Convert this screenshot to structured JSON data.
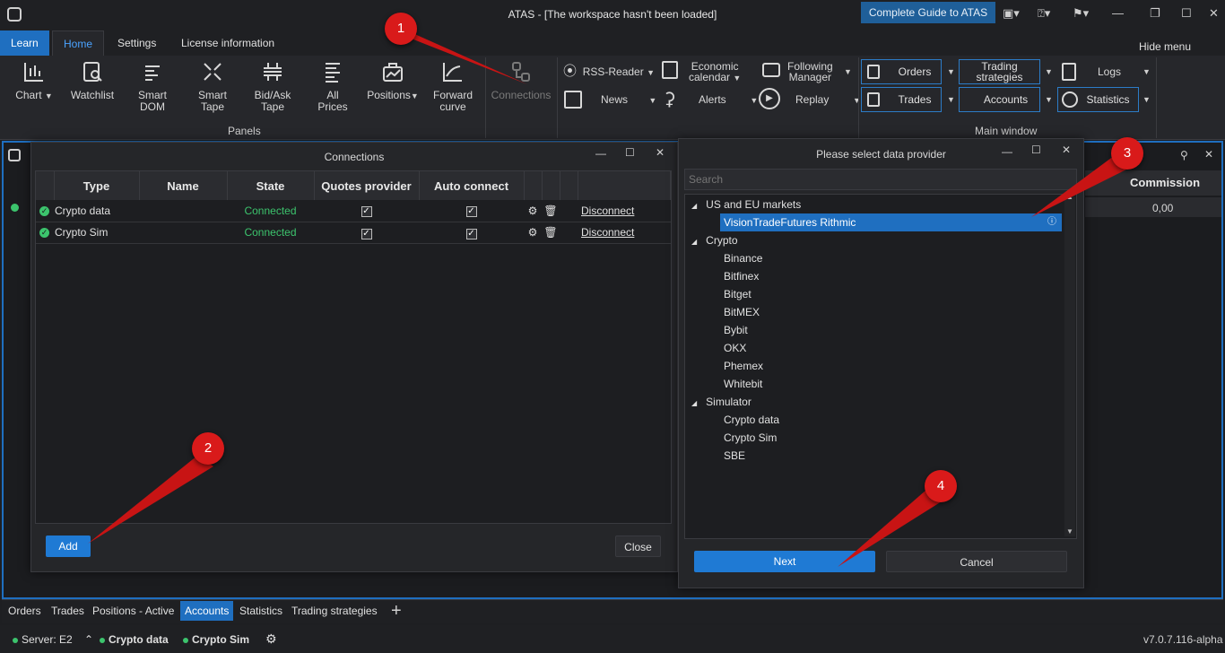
{
  "window": {
    "title": "ATAS - [The workspace hasn't been loaded]",
    "guide_button": "Complete Guide to ATAS"
  },
  "ribbon_tabs": [
    "Learn",
    "Home",
    "Settings",
    "License information"
  ],
  "hide_menu": "Hide menu",
  "panels": {
    "chart": "Chart",
    "watchlist": "Watchlist",
    "smart_dom": [
      "Smart",
      "DOM"
    ],
    "smart_tape": [
      "Smart",
      "Tape"
    ],
    "bidask_tape": [
      "Bid/Ask",
      "Tape"
    ],
    "all_prices": [
      "All",
      "Prices"
    ],
    "positions": "Positions",
    "forward_curve": [
      "Forward",
      "curve"
    ],
    "group_label": "Panels",
    "connections": "Connections"
  },
  "tools": {
    "rss": "RSS-Reader",
    "economic_calendar": [
      "Economic",
      "calendar"
    ],
    "following_manager": [
      "Following",
      "Manager"
    ],
    "news": "News",
    "alerts": "Alerts",
    "replay": "Replay"
  },
  "main_window": {
    "orders": "Orders",
    "trading_strategies": [
      "Trading",
      "strategies"
    ],
    "logs": "Logs",
    "trades": "Trades",
    "accounts": "Accounts",
    "statistics": "Statistics",
    "group_label": "Main window"
  },
  "connections_dialog": {
    "title": "Connections",
    "columns": [
      "Type",
      "Name",
      "State",
      "Quotes provider",
      "Auto connect"
    ],
    "rows": [
      {
        "type": "Crypto data",
        "name": "",
        "state": "Connected",
        "action": "Disconnect"
      },
      {
        "type": "Crypto Sim",
        "name": "",
        "state": "Connected",
        "action": "Disconnect"
      }
    ],
    "add": "Add",
    "close": "Close"
  },
  "provider_dialog": {
    "title": "Please select data provider",
    "search_placeholder": "Search",
    "groups": [
      {
        "name": "US and EU markets",
        "items": [
          "VisionTradeFutures Rithmic"
        ]
      },
      {
        "name": "Crypto",
        "items": [
          "Binance",
          "Bitfinex",
          "Bitget",
          "BitMEX",
          "Bybit",
          "OKX",
          "Phemex",
          "Whitebit"
        ]
      },
      {
        "name": "Simulator",
        "items": [
          "Crypto data",
          "Crypto Sim",
          "SBE"
        ]
      }
    ],
    "next": "Next",
    "cancel": "Cancel"
  },
  "background_panel": {
    "commission_header": "Commission",
    "commission_value": "0,00"
  },
  "bottom_tabs": [
    "Orders",
    "Trades",
    "Positions - Active",
    "Accounts",
    "Statistics",
    "Trading strategies"
  ],
  "status_bar": {
    "server": "Server: E2",
    "conn1": "Crypto data",
    "conn2": "Crypto Sim",
    "version": "v7.0.7.116-alpha"
  },
  "callouts": [
    "1",
    "2",
    "3",
    "4"
  ],
  "colors": {
    "accent": "#1f6fc0",
    "connected": "#3cc46d",
    "callout": "#d91a1a"
  }
}
